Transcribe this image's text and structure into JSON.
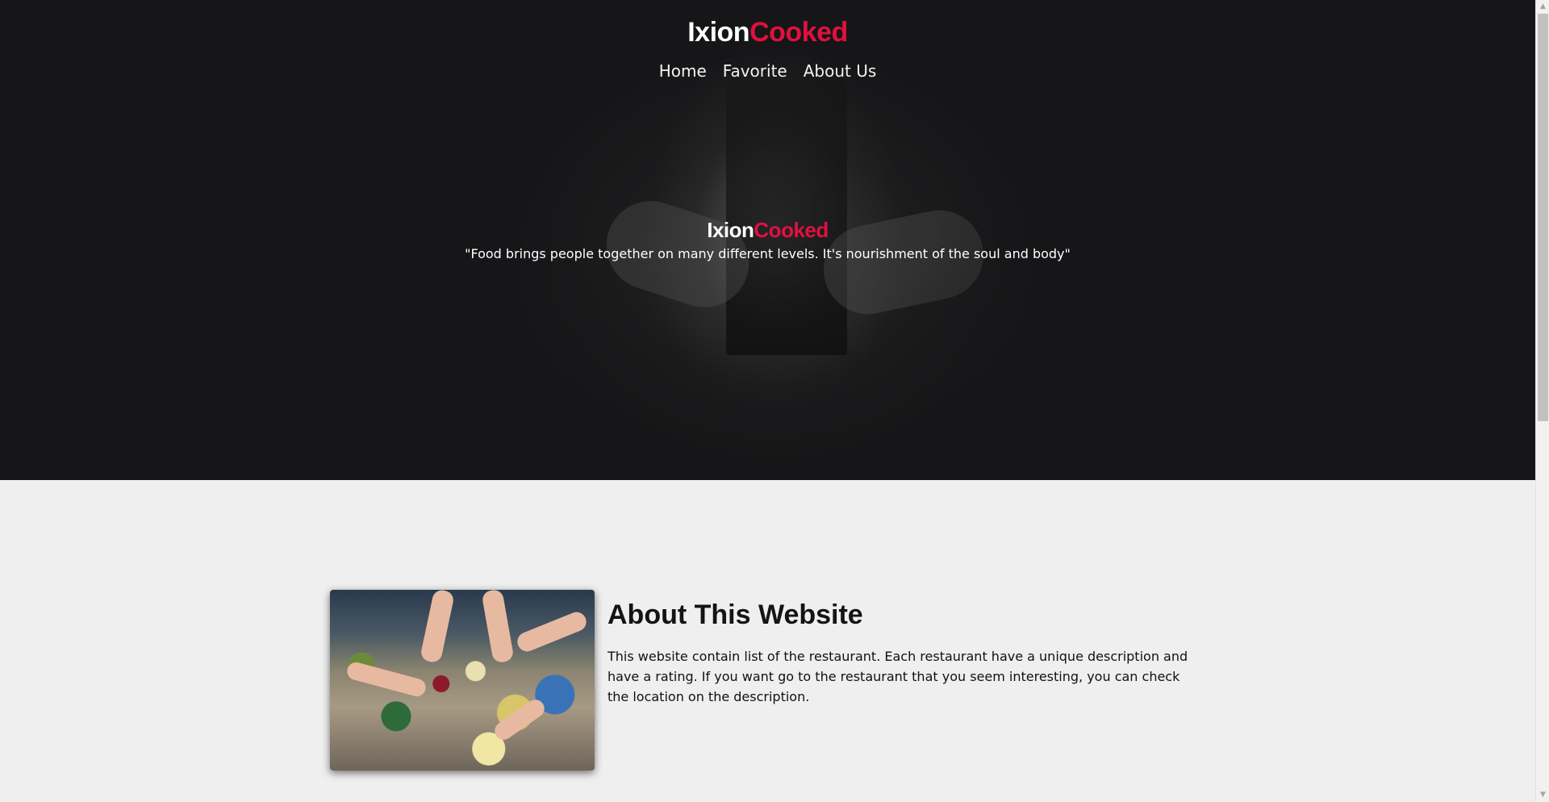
{
  "brand": {
    "part1": "Ixion",
    "part2": "Cooked"
  },
  "nav": {
    "items": [
      "Home",
      "Favorite",
      "About Us"
    ]
  },
  "hero": {
    "title_part1": "Ixion",
    "title_part2": "Cooked",
    "quote": "\"Food brings people together on many different levels. It's nourishment of the soul and body\""
  },
  "about": {
    "title": "About This Website",
    "text": "This website contain list of the restaurant. Each restaurant have a unique description and have a rating. If you want go to the restaurant that you seem interesting, you can check the location on the description."
  },
  "colors": {
    "accent": "#e2103f",
    "hero_bg": "#161618",
    "page_bg": "#efefef"
  },
  "scrollbar": {
    "up_icon": "chevron-up-icon",
    "down_icon": "chevron-down-icon"
  }
}
